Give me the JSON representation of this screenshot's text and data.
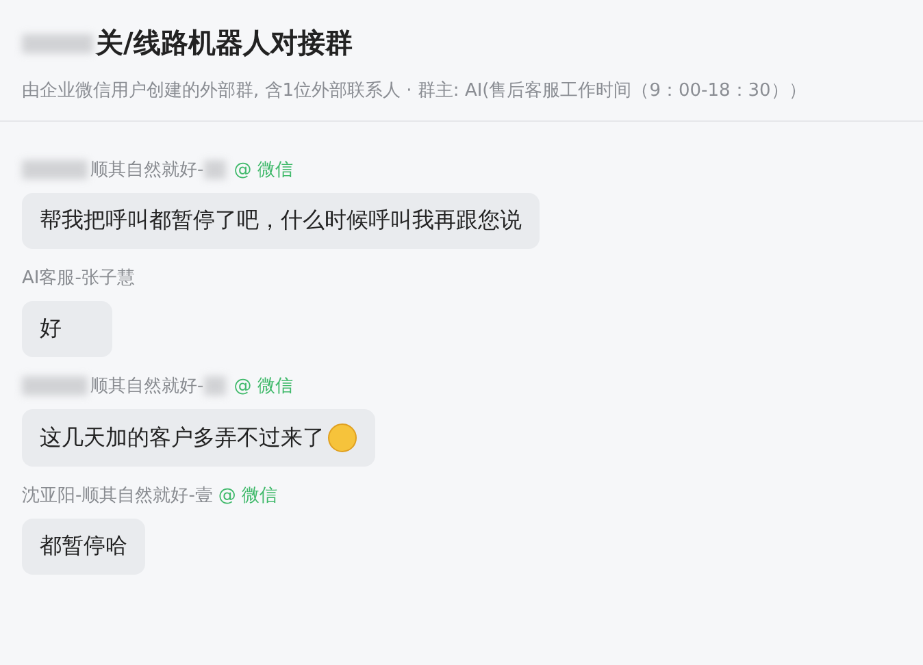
{
  "header": {
    "title": "关/线路机器人对接群",
    "title_blurred_prefix": true,
    "subtitle": "由企业微信用户创建的外部群, 含1位外部联系人 · 群主: AI(售后客服工作时间（9：00-18：30））"
  },
  "messages": [
    {
      "sender": "顺其自然就好-",
      "blurred_prefix": true,
      "blurred_suffix": true,
      "source": "@ 微信",
      "text": "帮我把呼叫都暂停了吧，什么时候呼叫我再跟您说",
      "emoji": false
    },
    {
      "sender": "AI客服-张子慧",
      "blurred_prefix": false,
      "blurred_suffix": false,
      "text": "好",
      "emoji": false
    },
    {
      "sender": "顺其自然就好-",
      "blurred_prefix": true,
      "blurred_suffix": true,
      "source": "@ 微信",
      "text": "这几天加的客户多弄不过来了",
      "emoji": true
    },
    {
      "sender": "沈亚阳-顺其自然就好-壹",
      "blurred_prefix": false,
      "blurred_suffix": false,
      "source": "@ 微信",
      "text": "都暂停哈",
      "emoji": false
    }
  ]
}
